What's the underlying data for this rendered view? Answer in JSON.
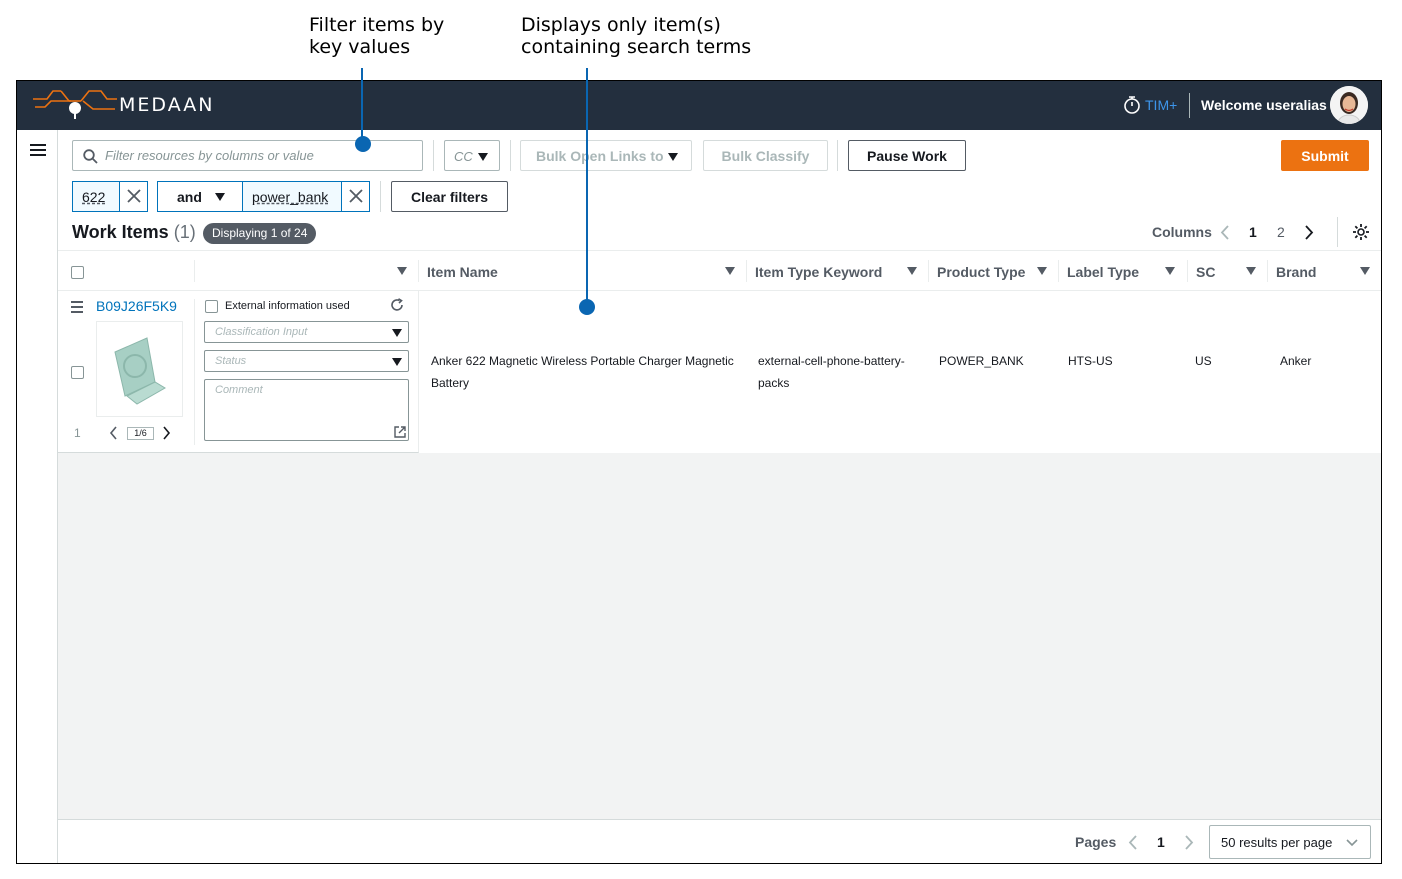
{
  "annotations": {
    "filter_note": "Filter items by\nkey values",
    "search_note": "Displays only item(s)\ncontaining search terms"
  },
  "header": {
    "brand": "MEDAAN",
    "timer_label": "TIM+",
    "welcome": "Welcome useralias"
  },
  "toolbar": {
    "search_placeholder": "Filter resources by columns or value",
    "cc_select": "CC",
    "bulk_open_links": "Bulk Open Links to",
    "bulk_classify": "Bulk Classify",
    "pause_work": "Pause Work",
    "submit": "Submit"
  },
  "filters": {
    "token1": "622",
    "operator": "and",
    "token2": "power_bank",
    "clear": "Clear filters"
  },
  "work_items": {
    "title": "Work Items",
    "count": "(1)",
    "badge": "Displaying 1 of 24"
  },
  "columns_pager": {
    "label": "Columns",
    "pages": [
      "1",
      "2"
    ],
    "current": "1"
  },
  "table": {
    "headers": [
      "Item Name",
      "Item Type Keyword",
      "Product Type",
      "Label Type",
      "SC",
      "Brand"
    ],
    "row": {
      "id": "B09J26F5K9",
      "index": "1",
      "image_counter": "1/6",
      "external_info": "External information used",
      "classification_placeholder": "Classification Input",
      "status_placeholder": "Status",
      "comment_placeholder": "Comment",
      "item_name": "Anker 622 Magnetic Wireless Portable Charger Magnetic Battery",
      "item_type_keyword": "external-cell-phone-battery-packs",
      "product_type": "POWER_BANK",
      "label_type": "HTS-US",
      "sc": "US",
      "brand": "Anker"
    }
  },
  "footer": {
    "pages_label": "Pages",
    "current_page": "1",
    "results_per_page": "50 results per page"
  },
  "colors": {
    "topbar": "#232f3e",
    "accent_orange": "#ec7211",
    "link_blue": "#0073bb",
    "annotation_blue": "#0a66b2"
  },
  "icons": [
    "menu-icon",
    "search-icon",
    "timer-icon",
    "close-icon",
    "refresh-icon",
    "settings-icon",
    "external-link-icon",
    "chevron-left-icon",
    "chevron-right-icon",
    "chevron-down-icon",
    "drag-handle-icon"
  ]
}
